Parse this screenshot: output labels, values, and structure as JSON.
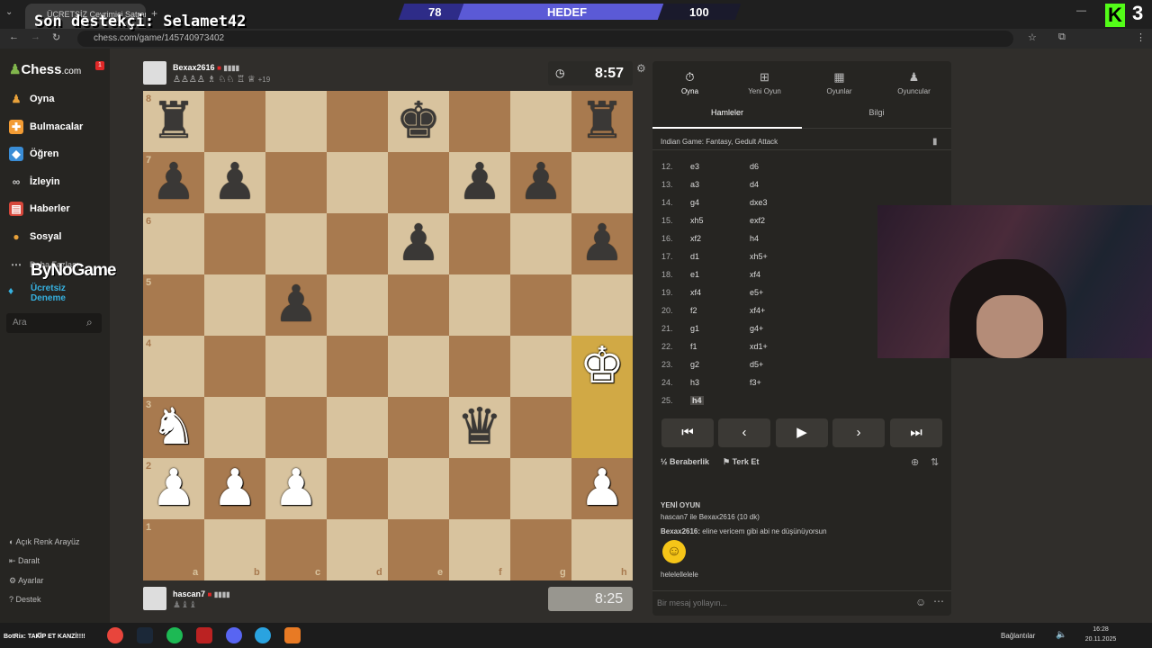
{
  "browser": {
    "tab_title": "ÜCRETSİZ Çevrimiçi Satranç O...",
    "url": "chess.com/game/145740973402"
  },
  "overlay": {
    "supporter": "Son destekçi: Selamet42",
    "goal_current": "78",
    "goal_label": "HEDEF",
    "goal_target": "100",
    "goal_progress": 0.78,
    "kick_number": "3",
    "bynogame": "ByNoGame",
    "bot_text": "BotRix: TAKİP ET KANZİ!!!!"
  },
  "sidebar": {
    "logo": "Chess",
    "logo_suffix": ".com",
    "badge": "1",
    "items": [
      {
        "label": "Oyna",
        "icon": "pawn-icon"
      },
      {
        "label": "Bulmacalar",
        "icon": "puzzle-icon"
      },
      {
        "label": "Öğren",
        "icon": "learn-icon"
      },
      {
        "label": "İzleyin",
        "icon": "binoculars-icon"
      },
      {
        "label": "Haberler",
        "icon": "news-icon"
      },
      {
        "label": "Sosyal",
        "icon": "social-icon"
      }
    ],
    "more": "Daha Fazlası",
    "free_trial": "Ücretsiz Deneme",
    "search_placeholder": "Ara",
    "footer": [
      "Açık Renk Arayüz",
      "Daralt",
      "Ayarlar",
      "Destek"
    ]
  },
  "top_player": {
    "name": "Bexax2616",
    "captures": "+19",
    "clock": "8:57"
  },
  "bottom_player": {
    "name": "hascan7",
    "clock": "8:25"
  },
  "board": {
    "files": [
      "a",
      "b",
      "c",
      "d",
      "e",
      "f",
      "g",
      "h"
    ],
    "ranks": [
      "8",
      "7",
      "6",
      "5",
      "4",
      "3",
      "2",
      "1"
    ],
    "pieces": [
      {
        "sq": "a8",
        "p": "♜",
        "c": "b"
      },
      {
        "sq": "e8",
        "p": "♚",
        "c": "b"
      },
      {
        "sq": "h8",
        "p": "♜",
        "c": "b"
      },
      {
        "sq": "a7",
        "p": "♟",
        "c": "b"
      },
      {
        "sq": "b7",
        "p": "♟",
        "c": "b"
      },
      {
        "sq": "f7",
        "p": "♟",
        "c": "b"
      },
      {
        "sq": "g7",
        "p": "♟",
        "c": "b"
      },
      {
        "sq": "e6",
        "p": "♟",
        "c": "b"
      },
      {
        "sq": "h6",
        "p": "♟",
        "c": "b"
      },
      {
        "sq": "c5",
        "p": "♟",
        "c": "b"
      },
      {
        "sq": "h4",
        "p": "♚",
        "c": "w"
      },
      {
        "sq": "a3",
        "p": "♞",
        "c": "w"
      },
      {
        "sq": "f3",
        "p": "♛",
        "c": "b"
      },
      {
        "sq": "a2",
        "p": "♟",
        "c": "w"
      },
      {
        "sq": "b2",
        "p": "♟",
        "c": "w"
      },
      {
        "sq": "c2",
        "p": "♟",
        "c": "w"
      },
      {
        "sq": "h2",
        "p": "♟",
        "c": "w"
      }
    ],
    "highlight": [
      "h4",
      "h3"
    ]
  },
  "panel": {
    "tabs": [
      "Oyna",
      "Yeni Oyun",
      "Oyunlar",
      "Oyuncular"
    ],
    "subtabs": [
      "Hamleler",
      "Bilgi"
    ],
    "opening": "Indian Game: Fantasy, Gedult Attack",
    "moves": [
      {
        "n": "12.",
        "w": "e3",
        "b": "d6"
      },
      {
        "n": "13.",
        "w": "a3",
        "b": "d4"
      },
      {
        "n": "14.",
        "w": "g4",
        "b": "dxe3"
      },
      {
        "n": "15.",
        "w": "xh5",
        "b": "exf2"
      },
      {
        "n": "16.",
        "w": "xf2",
        "b": "h4"
      },
      {
        "n": "17.",
        "w": "d1",
        "b": "xh5+"
      },
      {
        "n": "18.",
        "w": "e1",
        "b": "xf4"
      },
      {
        "n": "19.",
        "w": "xf4",
        "b": "e5+"
      },
      {
        "n": "20.",
        "w": "f2",
        "b": "xf4+"
      },
      {
        "n": "21.",
        "w": "g1",
        "b": "g4+"
      },
      {
        "n": "22.",
        "w": "f1",
        "b": "xd1+"
      },
      {
        "n": "23.",
        "w": "g2",
        "b": "d5+"
      },
      {
        "n": "24.",
        "w": "h3",
        "b": "f3+"
      },
      {
        "n": "25.",
        "w": "h4",
        "b": ""
      }
    ],
    "draw": "Beraberlik",
    "resign": "Terk Et",
    "new_game": "YENİ OYUN",
    "game_info_1": "hascan7",
    "game_info_2": " ile ",
    "game_info_3": "Bexax2616",
    "game_info_4": " (10 dk)",
    "chat_user": "Bexax2616:",
    "chat_msg": " eline vericem gibi abi ne düşünüyorsun",
    "chat_msg2": "helelellelele",
    "chat_placeholder": "Bir mesaj yollayın..."
  },
  "taskbar": {
    "network": "Bağlantılar",
    "time": "16:28",
    "date": "20.11.2025"
  }
}
